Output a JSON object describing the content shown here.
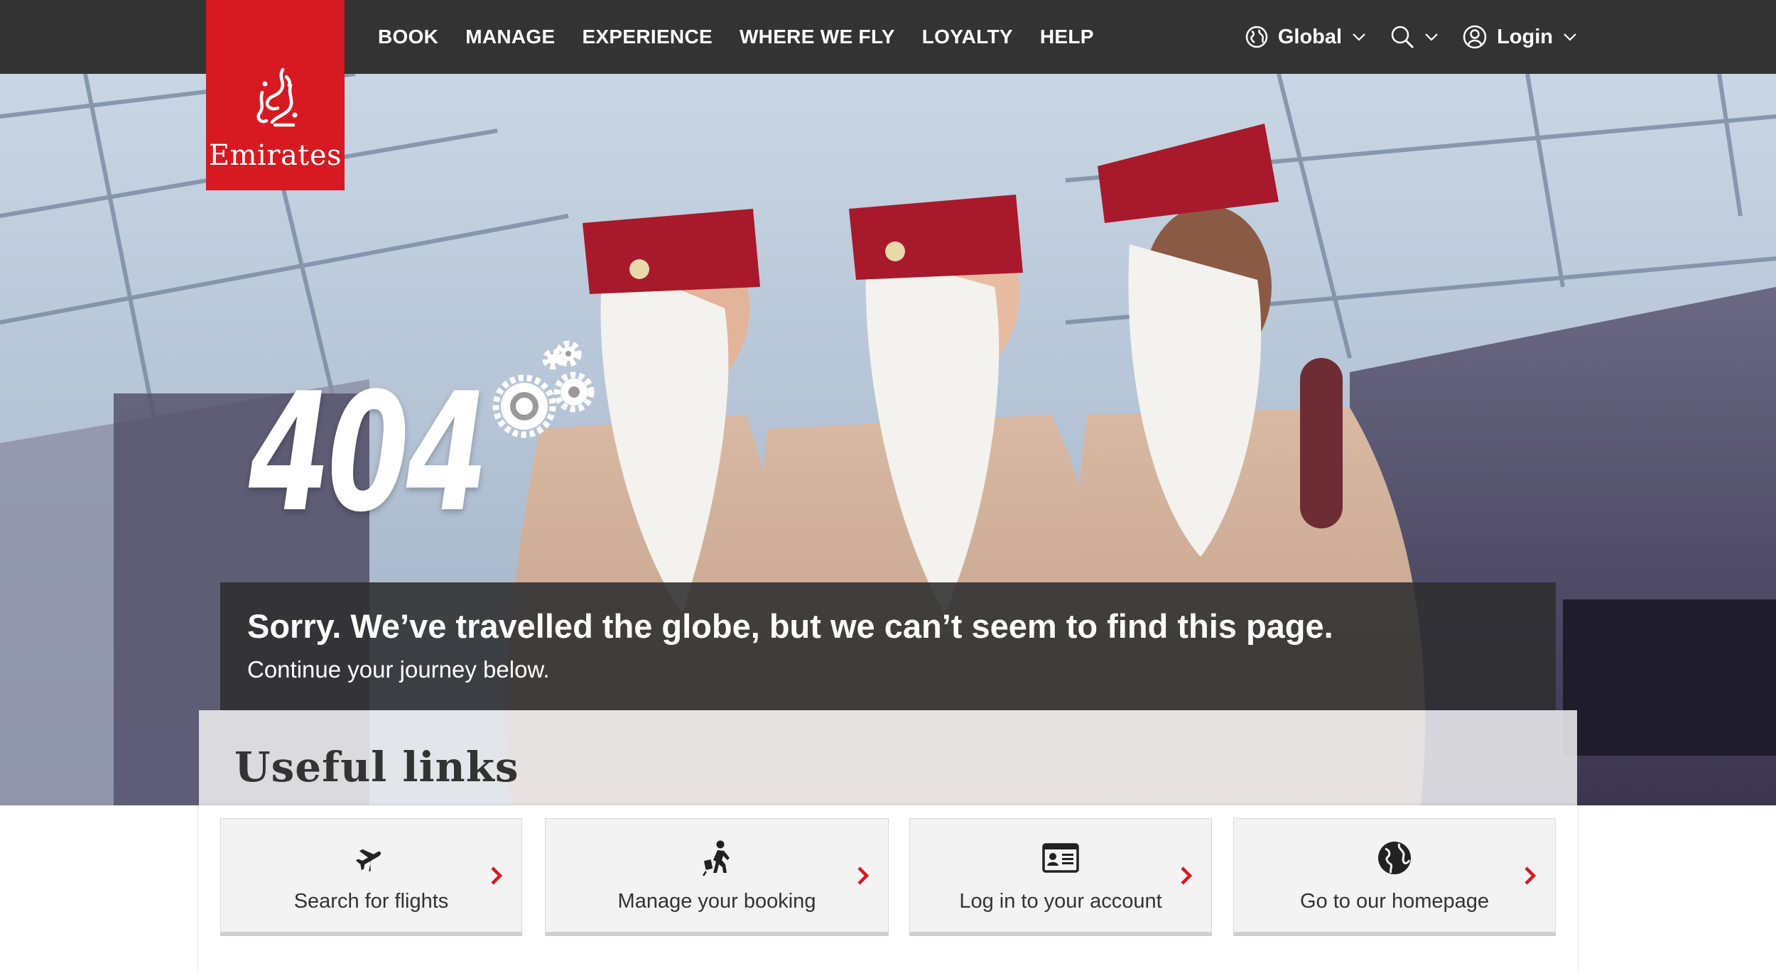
{
  "brand": {
    "name": "Emirates",
    "color": "#d71921"
  },
  "nav": {
    "items": [
      {
        "label": "BOOK"
      },
      {
        "label": "MANAGE"
      },
      {
        "label": "EXPERIENCE"
      },
      {
        "label": "WHERE WE FLY"
      },
      {
        "label": "LOYALTY"
      },
      {
        "label": "HELP"
      }
    ],
    "region": {
      "label": "Global",
      "icon": "globe-icon"
    },
    "search": {
      "icon": "search-icon"
    },
    "login": {
      "label": "Login",
      "icon": "user-icon"
    }
  },
  "error": {
    "code": "404",
    "title": "Sorry. We’ve travelled the globe, but we can’t seem to find this page.",
    "subtitle": "Continue your journey below."
  },
  "useful_links": {
    "heading": "Useful links",
    "links": [
      {
        "label": "Search for flights",
        "icon": "airplane-icon"
      },
      {
        "label": "Manage your booking",
        "icon": "traveller-icon"
      },
      {
        "label": "Log in to your account",
        "icon": "id-card-icon"
      },
      {
        "label": "Go to our homepage",
        "icon": "globe-icon"
      }
    ]
  },
  "colors": {
    "nav_bg": "#333333",
    "accent": "#d71921",
    "message_bg": "#2d2d30"
  }
}
